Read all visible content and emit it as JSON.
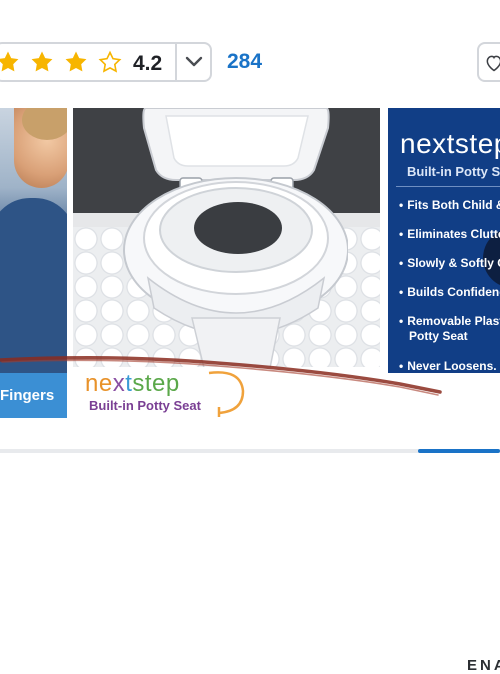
{
  "rating": {
    "value": "4.2",
    "stars_filled": 3,
    "stars_total": 4,
    "review_count": "284"
  },
  "colors": {
    "star": "#f7b500",
    "link": "#1a73c7",
    "accent_blue": "#113e86",
    "progress": "#1a73c7"
  },
  "icons": [
    "star-icon",
    "star-outline-icon",
    "chevron-down-icon",
    "heart-icon"
  ],
  "carousel": {
    "left_label": "Fingers",
    "middle": {
      "logo_parts": [
        "ne",
        "x",
        "t",
        "step"
      ],
      "logo_sub": "Built-in Potty Seat"
    },
    "right": {
      "logo_main": "nextstep",
      "logo_sub": "Built-in Potty Sea",
      "bullets": [
        "Fits Both Child &",
        "Eliminates Clutte",
        "Slowly & Softly C",
        "Builds Confidenc",
        "Removable Plast",
        "Never Loosens. C"
      ],
      "bullet_cont": "Potty Seat",
      "footer_text": "ENA"
    },
    "progress": 0.16
  }
}
